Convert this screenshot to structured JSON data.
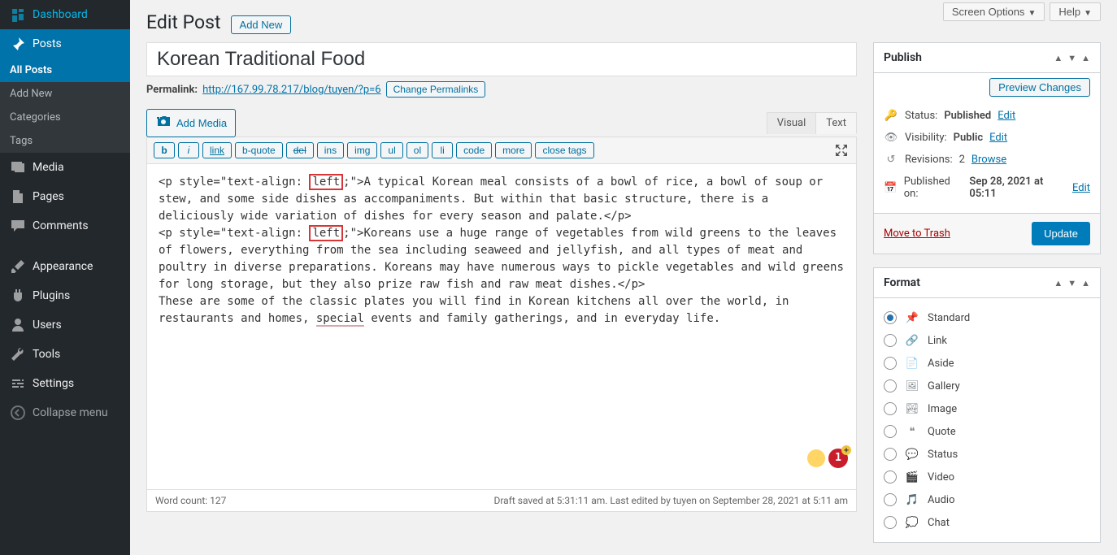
{
  "sidebar": {
    "dashboard": "Dashboard",
    "posts": "Posts",
    "sub": {
      "all": "All Posts",
      "add": "Add New",
      "cat": "Categories",
      "tags": "Tags"
    },
    "media": "Media",
    "pages": "Pages",
    "comments": "Comments",
    "appearance": "Appearance",
    "plugins": "Plugins",
    "users": "Users",
    "tools": "Tools",
    "settings": "Settings",
    "collapse": "Collapse menu"
  },
  "top": {
    "screen": "Screen Options",
    "help": "Help"
  },
  "heading": {
    "title": "Edit Post",
    "add": "Add New"
  },
  "post": {
    "title": "Korean Traditional Food"
  },
  "permalink": {
    "label": "Permalink:",
    "url": "http://167.99.78.217/blog/tuyen/?p=6",
    "change": "Change Permalinks"
  },
  "media_btn": "Add Media",
  "tabs": {
    "visual": "Visual",
    "text": "Text"
  },
  "qt": {
    "b": "b",
    "i": "i",
    "link": "link",
    "bquote": "b-quote",
    "del": "del",
    "ins": "ins",
    "img": "img",
    "ul": "ul",
    "ol": "ol",
    "li": "li",
    "code": "code",
    "more": "more",
    "close": "close tags"
  },
  "content": {
    "p1_a": "<p style=\"text-align: ",
    "p1_hl": "left",
    "p1_b": ";\">A typical Korean meal consists of a bowl of rice, a bowl of soup or stew, and some side dishes as accompaniments. But within that basic structure, there is a deliciously wide variation of dishes for every season and palate.</p>",
    "p2_a": "<p style=\"text-align: ",
    "p2_hl": "left",
    "p2_b": ";\">Koreans use a huge range of vegetables from wild greens to the leaves of flowers, everything from the sea including seaweed and jellyfish, and all types of meat and poultry in diverse preparations. Koreans may have numerous ways to pickle vegetables and wild greens for long storage, but they also prize raw fish and raw meat dishes.</p>",
    "p3_a": "These are some of the classic plates you will find in Korean kitchens all over the world, in restaurants and homes, ",
    "p3_sp": "special",
    "p3_b": " events and family gatherings, and in everyday life."
  },
  "statusbar": {
    "wc": "Word count: 127",
    "draft": "Draft saved at 5:31:11 am. Last edited by tuyen on September 28, 2021 at 5:11 am"
  },
  "badge": "1",
  "publish": {
    "title": "Publish",
    "preview": "Preview Changes",
    "status_l": "Status:",
    "status_v": "Published",
    "status_e": "Edit",
    "vis_l": "Visibility:",
    "vis_v": "Public",
    "vis_e": "Edit",
    "rev_l": "Revisions:",
    "rev_v": "2",
    "rev_b": "Browse",
    "pub_l": "Published on:",
    "pub_v": "Sep 28, 2021 at 05:11",
    "pub_e": "Edit",
    "trash": "Move to Trash",
    "update": "Update"
  },
  "format": {
    "title": "Format",
    "opts": [
      "Standard",
      "Link",
      "Aside",
      "Gallery",
      "Image",
      "Quote",
      "Status",
      "Video",
      "Audio",
      "Chat"
    ]
  }
}
